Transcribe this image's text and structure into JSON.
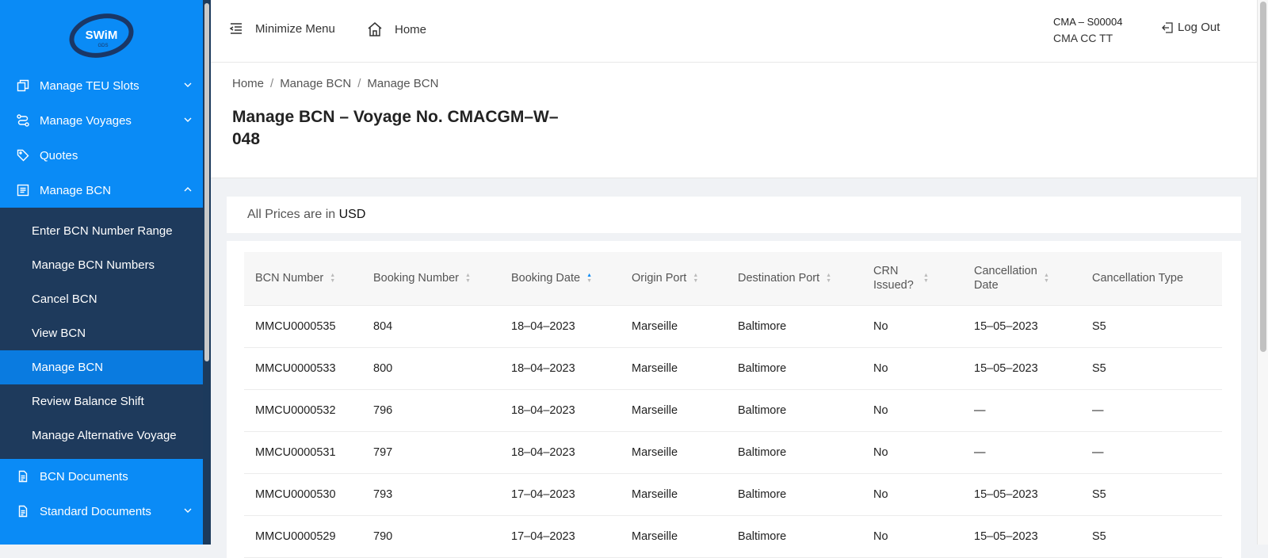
{
  "logo": {
    "text": "SWiM",
    "sub": "GDS"
  },
  "sidebar": {
    "items": [
      {
        "label": "Manage TEU Slots",
        "icon": "copy-icon",
        "expandable": true
      },
      {
        "label": "Manage Voyages",
        "icon": "route-icon",
        "expandable": true
      },
      {
        "label": "Quotes",
        "icon": "tag-icon",
        "expandable": false
      },
      {
        "label": "Manage BCN",
        "icon": "list-icon",
        "expandable": true,
        "expanded": true
      }
    ],
    "bcn_sub": [
      {
        "label": "Enter BCN Number Range"
      },
      {
        "label": "Manage BCN Numbers"
      },
      {
        "label": "Cancel BCN"
      },
      {
        "label": "View BCN"
      },
      {
        "label": "Manage BCN",
        "active": true
      },
      {
        "label": "Review Balance Shift"
      },
      {
        "label": "Manage Alternative Voyage"
      }
    ],
    "bottom_items": [
      {
        "label": "BCN Documents",
        "icon": "document-icon",
        "expandable": false
      },
      {
        "label": "Standard Documents",
        "icon": "document-icon",
        "expandable": true
      }
    ]
  },
  "topbar": {
    "minimize_label": "Minimize Menu",
    "home_label": "Home",
    "user_id": "CMA – S00004",
    "user_name": "CMA CC TT",
    "logout_label": "Log Out"
  },
  "breadcrumb": [
    "Home",
    "Manage BCN",
    "Manage BCN"
  ],
  "page_title": "Manage BCN – Voyage No. CMACGM–W–048",
  "currency": {
    "prefix": "All Prices are in",
    "code": "USD"
  },
  "table": {
    "columns": [
      "BCN Number",
      "Booking Number",
      "Booking Date",
      "Origin Port",
      "Destination Port",
      "CRN Issued?",
      "Cancellation Date",
      "Cancellation Type"
    ],
    "rows": [
      [
        "MMCU0000535",
        "804",
        "18–04–2023",
        "Marseille",
        "Baltimore",
        "No",
        "15–05–2023",
        "S5"
      ],
      [
        "MMCU0000533",
        "800",
        "18–04–2023",
        "Marseille",
        "Baltimore",
        "No",
        "15–05–2023",
        "S5"
      ],
      [
        "MMCU0000532",
        "796",
        "18–04–2023",
        "Marseille",
        "Baltimore",
        "No",
        "—",
        "—"
      ],
      [
        "MMCU0000531",
        "797",
        "18–04–2023",
        "Marseille",
        "Baltimore",
        "No",
        "—",
        "—"
      ],
      [
        "MMCU0000530",
        "793",
        "17–04–2023",
        "Marseille",
        "Baltimore",
        "No",
        "15–05–2023",
        "S5"
      ],
      [
        "MMCU0000529",
        "790",
        "17–04–2023",
        "Marseille",
        "Baltimore",
        "No",
        "15–05–2023",
        "S5"
      ]
    ]
  }
}
